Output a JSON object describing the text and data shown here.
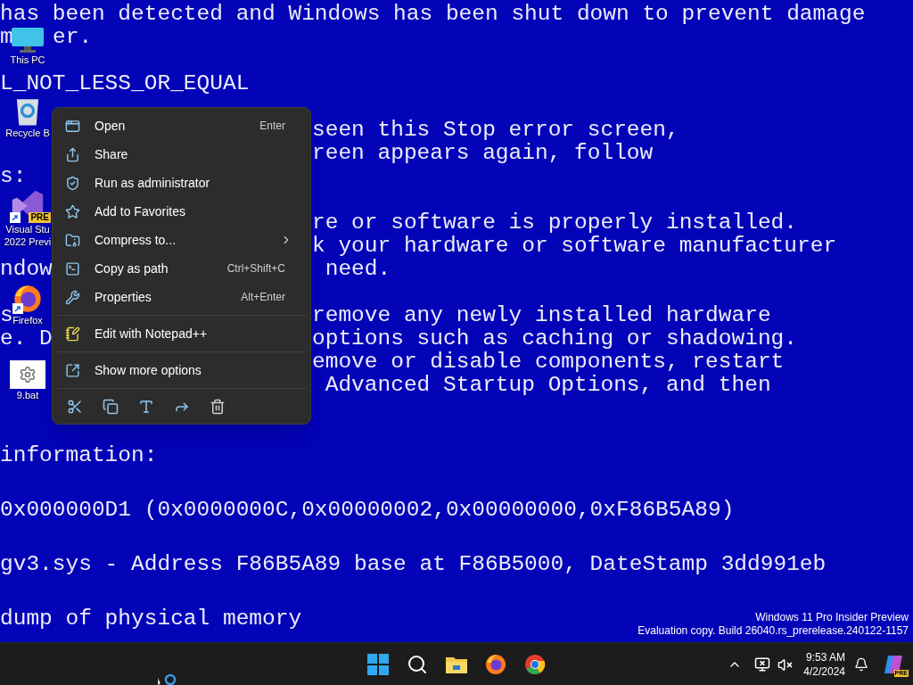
{
  "wallpaper": {
    "paragraphs": [
      [
        {
          "left": "has been detected and Windows has been shut down to prevent damage"
        },
        {
          "left": "m",
          "right": "er."
        }
      ],
      [
        {
          "left": "L_NOT_LESS_OR_EQUAL"
        }
      ],
      [
        {
          "right": "seen this Stop error screen,"
        },
        {
          "right": "reen appears again, follow"
        },
        {
          "left": "s:"
        }
      ],
      [
        {
          "right": "re or software is properly installed."
        },
        {
          "right": "k your hardware or software manufacturer"
        },
        {
          "left": "ndow",
          "right": " need."
        }
      ],
      [
        {
          "left": "s",
          "right": "remove any newly installed hardware"
        },
        {
          "left": "e. D",
          "right": "options such as caching or shadowing."
        },
        {
          "right": "emove or disable components, restart"
        },
        {
          "right": " Advanced Startup Options, and then"
        }
      ],
      [
        {
          "left": "information:"
        }
      ],
      [
        {
          "left": "0x000000D1 (0x0000000C,0x00000002,0x00000000,0xF86B5A89)"
        }
      ],
      [
        {
          "left": "gv3.sys - Address F86B5A89 base at F86B5000, DateStamp 3dd991eb"
        }
      ],
      [
        {
          "left": "dump of physical memory"
        }
      ]
    ]
  },
  "desktop_icons": [
    {
      "label": [
        "This PC"
      ]
    },
    {
      "label": [
        "Recycle B"
      ]
    },
    {
      "label": [
        "Visual Stu",
        "2022 Previ"
      ],
      "badge": "PRE"
    },
    {
      "label": [
        "Firefox"
      ]
    },
    {
      "label": [
        "9.bat"
      ]
    }
  ],
  "context_menu": {
    "groups": [
      [
        {
          "label": "Open",
          "shortcut": "Enter",
          "submenu": false
        },
        {
          "label": "Share",
          "submenu": false
        },
        {
          "label": "Run as administrator",
          "submenu": false
        },
        {
          "label": "Add to Favorites",
          "submenu": false
        },
        {
          "label": "Compress to...",
          "submenu": true
        },
        {
          "label": "Copy as path",
          "shortcut": "Ctrl+Shift+C",
          "submenu": false
        },
        {
          "label": "Properties",
          "shortcut": "Alt+Enter",
          "submenu": false
        }
      ],
      [
        {
          "label": "Edit with Notepad++",
          "submenu": false
        }
      ],
      [
        {
          "label": "Show more options",
          "submenu": false
        }
      ]
    ]
  },
  "watermark": {
    "edition": "Windows 11 Pro Insider Preview",
    "build": "Evaluation copy. Build 26040.rs_prerelease.240122-1157"
  },
  "taskbar": {
    "time": "9:53 AM",
    "date": "4/2/2024",
    "copilot_badge": "PRE"
  }
}
